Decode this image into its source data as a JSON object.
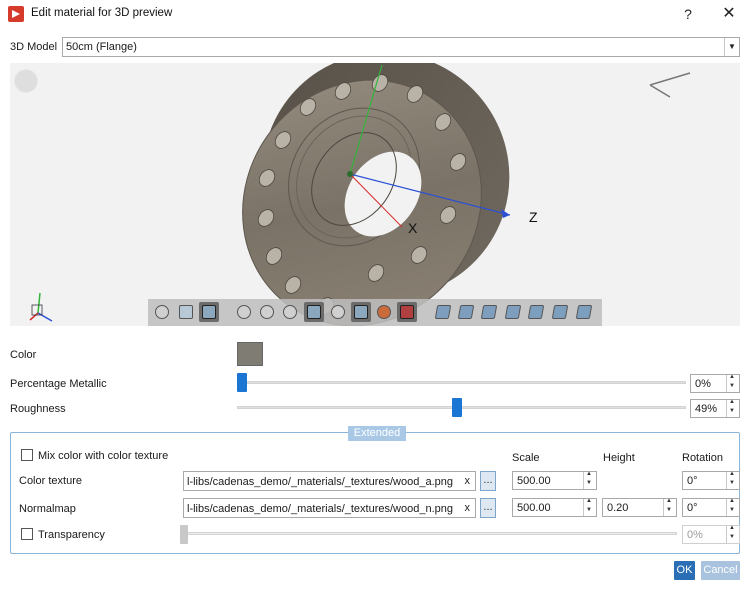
{
  "window": {
    "title": "Edit material for 3D preview",
    "help": "?",
    "close": "✕"
  },
  "model": {
    "label": "3D Model",
    "value": "50cm (Flange)"
  },
  "viewport": {
    "axis_x": "X",
    "axis_z": "Z"
  },
  "color": {
    "label": "Color",
    "swatch": "#7f7d73"
  },
  "metallic": {
    "label": "Percentage Metallic",
    "value": "0%",
    "fraction": 0.0
  },
  "roughness": {
    "label": "Roughness",
    "value": "49%",
    "fraction": 0.49
  },
  "extended": {
    "tag": "Extended",
    "mix_label": "Mix color with color texture",
    "headers": {
      "scale": "Scale",
      "height": "Height",
      "rotation": "Rotation"
    },
    "color_texture": {
      "label": "Color texture",
      "path": "l-libs/cadenas_demo/_materials/_textures/wood_a.png",
      "clear": "x",
      "browse": "...",
      "scale": "500.00",
      "rotation": "0°"
    },
    "normalmap": {
      "label": "Normalmap",
      "path": "l-libs/cadenas_demo/_materials/_textures/wood_n.png",
      "clear": "x",
      "browse": "...",
      "scale": "500.00",
      "height": "0.20",
      "rotation": "0°"
    },
    "transparency": {
      "label": "Transparency",
      "value": "0%",
      "fraction": 0.0
    }
  },
  "buttons": {
    "ok": "OK",
    "cancel": "Cancel"
  },
  "colors": {
    "accent": "#1a76d2",
    "ok": "#2a6fb5",
    "cancel": "#a9c3de",
    "frame": "#8ab4d9"
  }
}
